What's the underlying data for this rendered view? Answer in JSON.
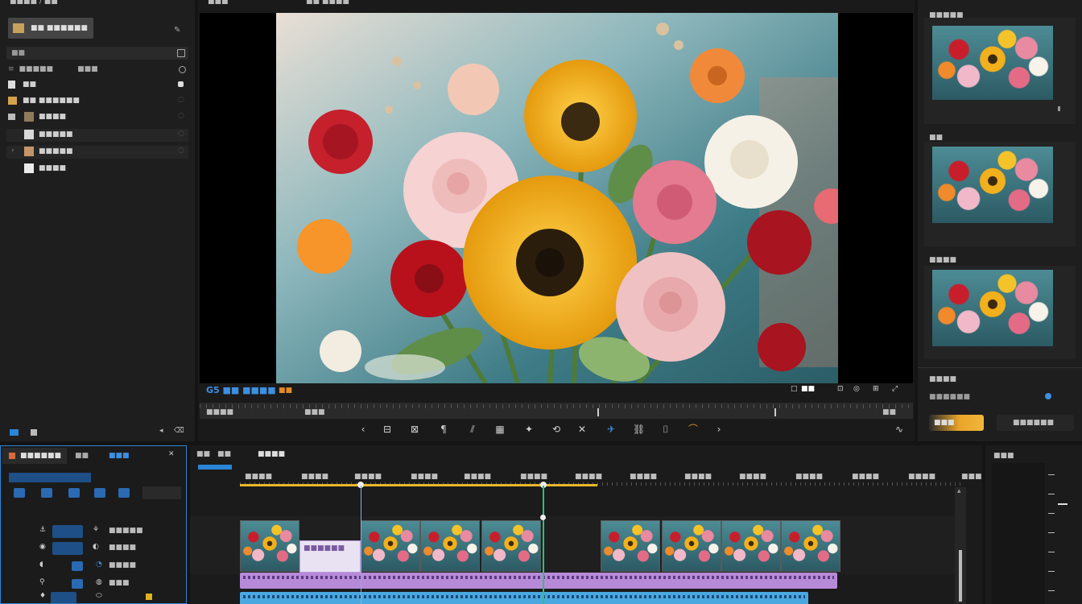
{
  "project": {
    "breadcrumb": "■■■■ / ■■",
    "bin_name": "■■ ■■■■■■",
    "search_placeholder": "■■",
    "col_name": "■■■■■",
    "col_type": "■■■",
    "items": [
      {
        "label": "■■"
      },
      {
        "label": "■■ ■■■■■■"
      },
      {
        "label": "■■■■"
      },
      {
        "label": "■■■■■"
      },
      {
        "label": "■■■■■"
      },
      {
        "label": "■■■■"
      }
    ]
  },
  "viewer": {
    "header_left": "■■■",
    "header_mid": "■■ ■■■■",
    "label_left": "G5 ■■ ■■■■",
    "label_icon": "■■",
    "counter": "■■",
    "time_left": "■■■■",
    "time_mid": "■■■",
    "time_right": "■■"
  },
  "inspector": {
    "title": "■■■■■",
    "card1": "■■",
    "card2": "■■■■",
    "section": "■■■■",
    "sub": "■■■■■■",
    "btn_primary": "■■■",
    "btn_secondary": "■■■■■■"
  },
  "effects": {
    "tab_active": "■■■■■■",
    "tab2": "■■",
    "tab3": "■■■",
    "tracks": [
      {
        "label": "■■■■■"
      },
      {
        "label": "■■■■"
      },
      {
        "label": "■■■■"
      },
      {
        "label": "■■■"
      }
    ]
  },
  "timeline": {
    "toolbar": [
      "■■",
      "■■",
      "■■■■"
    ],
    "ruler": [
      "■■■■",
      "■■■■",
      "■■■■",
      "■■■■",
      "■■■■",
      "■■■■",
      "■■■■",
      "■■■■",
      "■■■■",
      "■■■■",
      "■■■■",
      "■■■■",
      "■■■■",
      "■■■■"
    ],
    "title_clip": "■■■■■■"
  },
  "audio": {
    "title": "■■■"
  },
  "colors": {
    "accent": "#2b84d6",
    "playhead": "#2ec07a",
    "range": "#e9b72a",
    "purple_track": "#b78ad8",
    "blue_track": "#4aa8e0"
  }
}
